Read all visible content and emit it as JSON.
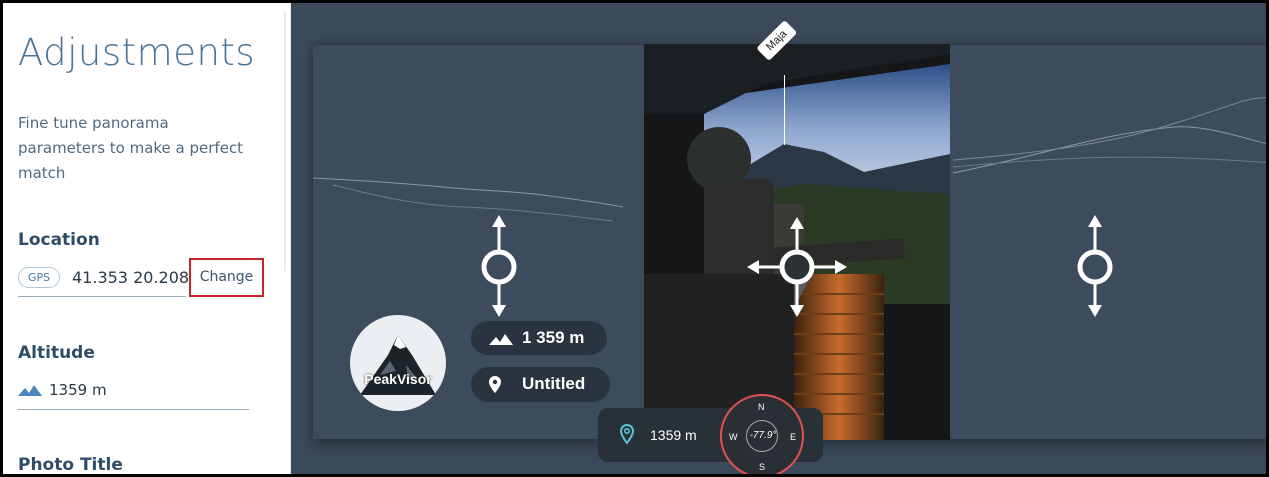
{
  "sidebar": {
    "title": "Adjustments",
    "description": "Fine tune panorama parameters to make a perfect match",
    "location": {
      "heading": "Location",
      "badge": "GPS",
      "coordinates": "41.353 20.208",
      "change_label": "Change"
    },
    "altitude": {
      "heading": "Altitude",
      "value": "1359 m"
    },
    "photo_title": {
      "heading": "Photo Title"
    }
  },
  "viewer": {
    "peak_label": "Maja",
    "altitude_pill": "1 359 m",
    "title_pill": "Untitled",
    "logo_text": "PeakVisor",
    "bottom_altitude": "1359 m",
    "compass": {
      "north": "N",
      "east": "E",
      "south": "S",
      "west": "W",
      "heading": "-77.9°"
    }
  },
  "colors": {
    "accent": "#4a7497",
    "highlight_box": "#c8232c",
    "main_bg": "#3b4a5a",
    "compass_ring": "#e05252"
  }
}
